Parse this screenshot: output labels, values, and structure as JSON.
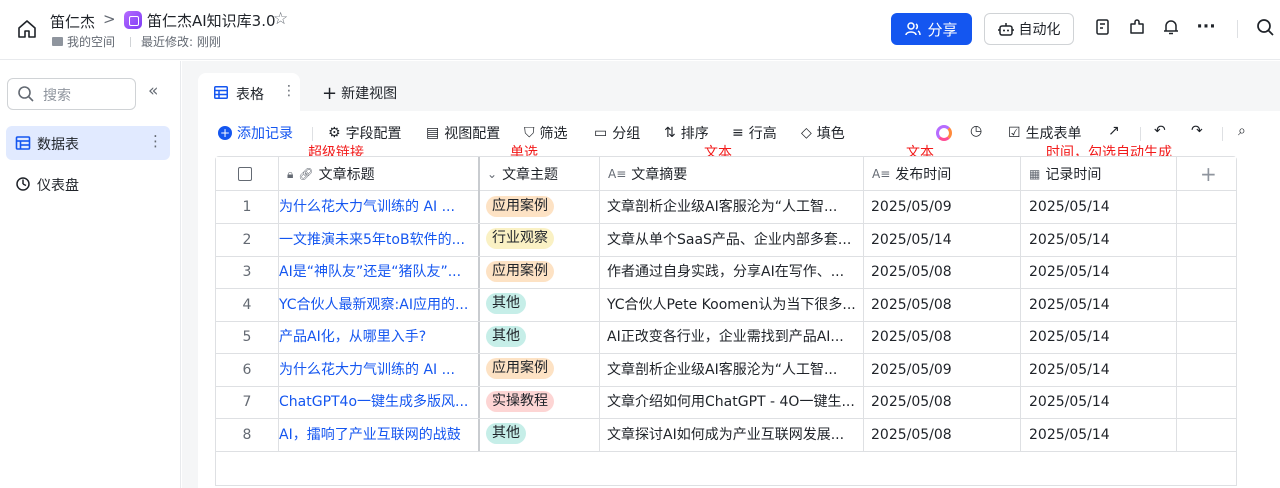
{
  "header": {
    "breadcrumb_root": "笛仁杰",
    "breadcrumb_sep": ">",
    "doc_title": "笛仁杰AI知识库3.0",
    "space": "我的空间",
    "last_modified": "最近修改: 刚刚",
    "share_label": "分享",
    "automation_label": "自动化",
    "more": "···"
  },
  "sidebar": {
    "search_placeholder": "搜索",
    "collapse": "«",
    "items": [
      {
        "label": "数据表",
        "more": "⋮",
        "active": true
      },
      {
        "label": "仪表盘",
        "active": false
      }
    ]
  },
  "views": {
    "active_tab": "表格",
    "tab_more": "⋮",
    "new_view": "新建视图"
  },
  "toolbar": {
    "add_record": "添加记录",
    "field_config": "字段配置",
    "view_config": "视图配置",
    "filter": "筛选",
    "group": "分组",
    "sort": "排序",
    "row_height": "行高",
    "fill_color": "填色",
    "generate_form": "生成表单"
  },
  "annotations": {
    "hyperlink": "超级链接",
    "single_select": "单选",
    "text1": "文本",
    "text2": "文本",
    "time_auto": "时间，勾选自动生成"
  },
  "table": {
    "columns": {
      "title": "文章标题",
      "topic": "文章主题",
      "summary": "文章摘要",
      "publish_time": "发布时间",
      "record_time": "记录时间"
    },
    "add_column": "+",
    "add_row": "+",
    "tag_colors": {
      "应用案例": "#fde2c4",
      "行业观察": "#faf1c4",
      "其他": "#c6eee8",
      "实操教程": "#fdd5d4"
    },
    "rows": [
      {
        "n": "1",
        "title": "为什么花大力气训练的 AI ...",
        "topic": "应用案例",
        "summary": "文章剖析企业级AI客服沦为“人工智...",
        "publish": "2025/05/09",
        "record": "2025/05/14"
      },
      {
        "n": "2",
        "title": "一文推演未来5年toB软件的...",
        "topic": "行业观察",
        "summary": "文章从单个SaaS产品、企业内部多套...",
        "publish": "2025/05/14",
        "record": "2025/05/14"
      },
      {
        "n": "3",
        "title": "AI是“神队友”还是“猪队友”...",
        "topic": "应用案例",
        "summary": "作者通过自身实践，分享AI在写作、...",
        "publish": "2025/05/08",
        "record": "2025/05/14"
      },
      {
        "n": "4",
        "title": "YC合伙人最新观察:AI应用的...",
        "topic": "其他",
        "summary": "YC合伙人Pete Koomen认为当下很多...",
        "publish": "2025/05/08",
        "record": "2025/05/14"
      },
      {
        "n": "5",
        "title": "产品AI化，从哪里入手?",
        "topic": "其他",
        "summary": "AI正改变各行业，企业需找到产品AI...",
        "publish": "2025/05/08",
        "record": "2025/05/14"
      },
      {
        "n": "6",
        "title": "为什么花大力气训练的 AI ...",
        "topic": "应用案例",
        "summary": "文章剖析企业级AI客服沦为“人工智...",
        "publish": "2025/05/09",
        "record": "2025/05/14"
      },
      {
        "n": "7",
        "title": "ChatGPT4o一键生成多版风...",
        "topic": "实操教程",
        "summary": "文章介绍如何用ChatGPT - 4O一键生...",
        "publish": "2025/05/08",
        "record": "2025/05/14"
      },
      {
        "n": "8",
        "title": "AI，擂响了产业互联网的战鼓",
        "topic": "其他",
        "summary": "文章探讨AI如何成为产业互联网发展...",
        "publish": "2025/05/08",
        "record": "2025/05/14"
      }
    ]
  }
}
